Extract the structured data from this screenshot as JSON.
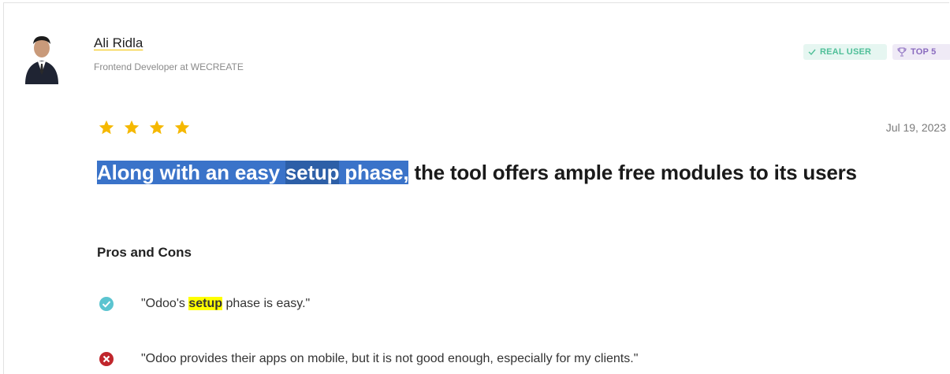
{
  "reviewer": {
    "name": "Ali Ridla",
    "title": "Frontend Developer at WECREATE"
  },
  "badges": {
    "real_user": "REAL USER",
    "top5": "TOP 5"
  },
  "rating": {
    "stars": 4,
    "max": 5
  },
  "date": "Jul 19, 2023",
  "headline": {
    "part1": "Along with an easy ",
    "part2": "setup",
    "part3": " phase,",
    "rest": " the tool offers ample free modules to its users"
  },
  "pros_cons": {
    "title": "Pros and Cons",
    "pro": {
      "before": "\"Odoo's ",
      "highlight": "setup",
      "after": " phase is easy.\""
    },
    "con": "\"Odoo provides their apps on mobile, but it is not good enough, especially for my clients.\""
  },
  "colors": {
    "pro": "#5bc4d0",
    "con": "#c0262c",
    "star": "#f5b800",
    "selection": "#3a73c9"
  }
}
